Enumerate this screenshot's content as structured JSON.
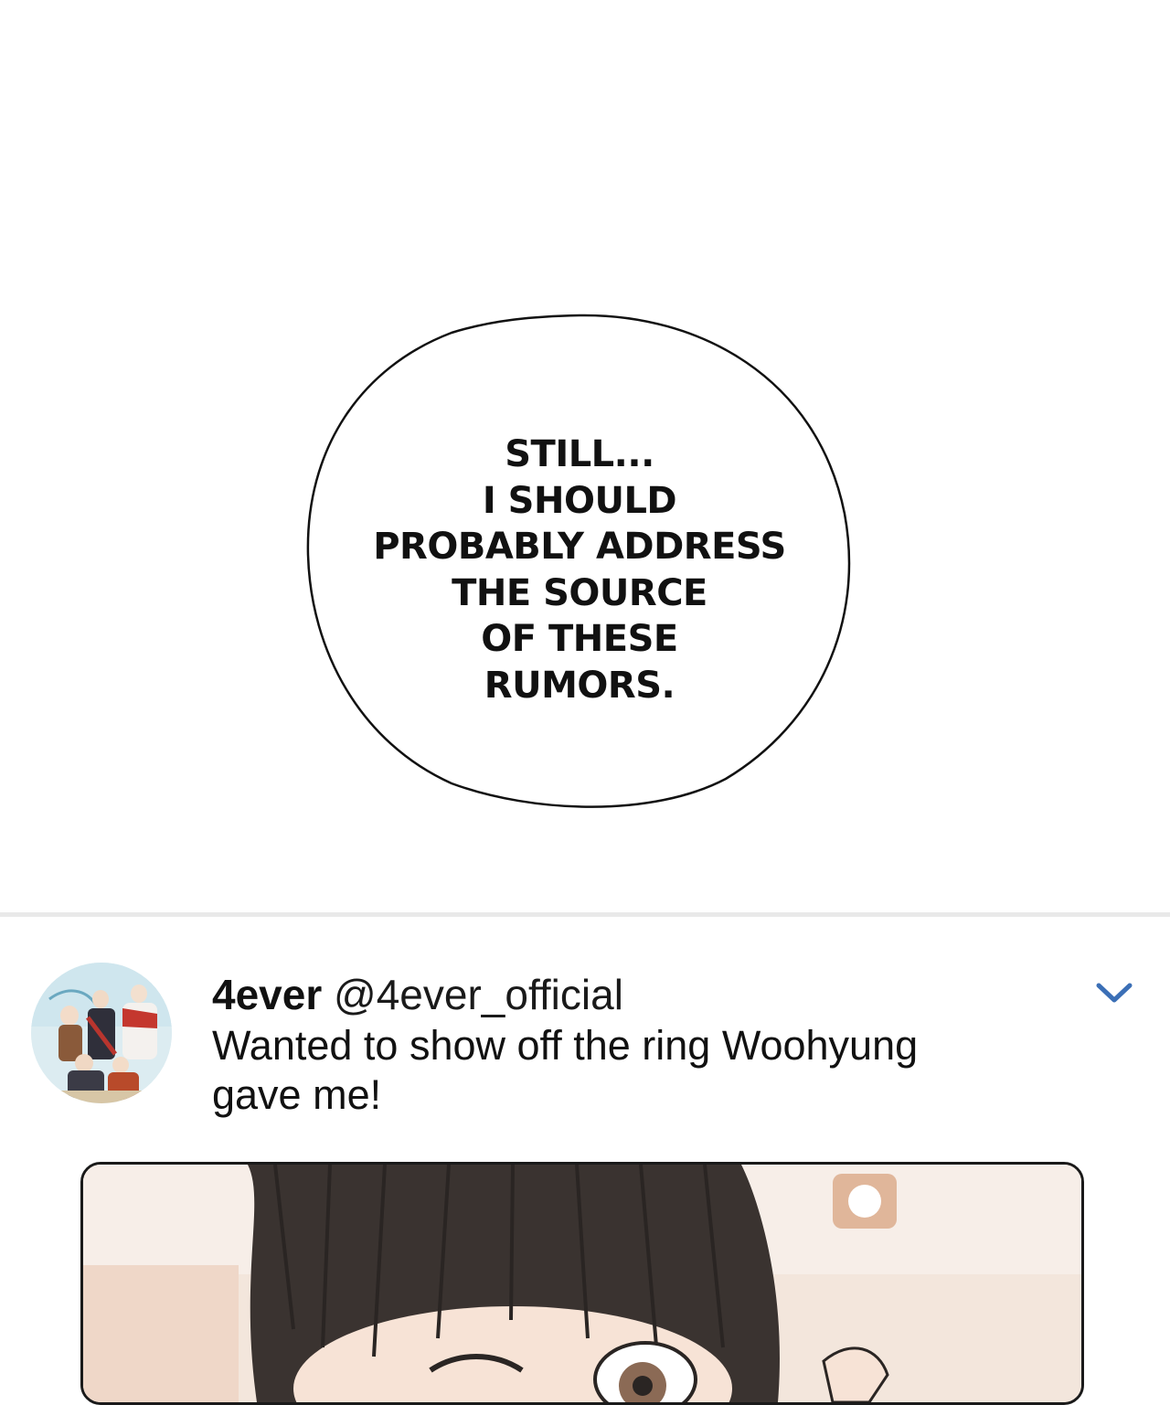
{
  "speech_bubble": {
    "lines": [
      "STILL...",
      "I SHOULD",
      "PROBABLY ADDRESS",
      "THE SOURCE",
      "OF THESE",
      "RUMORS."
    ]
  },
  "tweet": {
    "display_name": "4ever",
    "handle": "@4ever_official",
    "text_line1": "Wanted to show off the ring Woohyung",
    "text_line2": "gave me!",
    "menu_icon": "chevron-down-icon",
    "accent_color": "#3b6fb6"
  }
}
